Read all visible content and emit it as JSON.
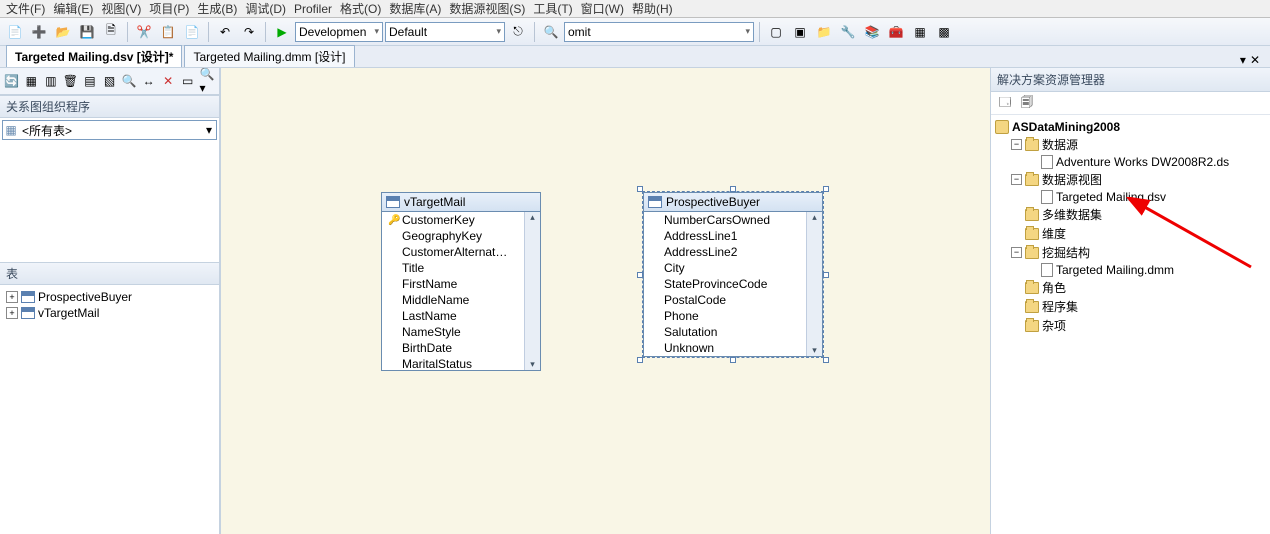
{
  "menu": {
    "items": [
      "文件(F)",
      "编辑(E)",
      "视图(V)",
      "项目(P)",
      "生成(B)",
      "调试(D)",
      "Profiler",
      "格式(O)",
      "数据库(A)",
      "数据源视图(S)",
      "工具(T)",
      "窗口(W)",
      "帮助(H)"
    ]
  },
  "toolbar": {
    "run_label": "Developmen",
    "config_label": "Default",
    "find_value": "omit"
  },
  "docTabs": {
    "active": "Targeted Mailing.dsv [设计]*",
    "other": "Targeted Mailing.dmm [设计]"
  },
  "leftPanel": {
    "diagramOrganizer": "关系图组织程序",
    "allTablesFilter": "<所有表>",
    "tablesHeader": "表",
    "tables": [
      "ProspectiveBuyer",
      "vTargetMail"
    ]
  },
  "canvas": {
    "table1": {
      "title": "vTargetMail",
      "cols": [
        "CustomerKey",
        "GeographyKey",
        "CustomerAlternat…",
        "Title",
        "FirstName",
        "MiddleName",
        "LastName",
        "NameStyle",
        "BirthDate",
        "MaritalStatus"
      ],
      "keyIndex": 0
    },
    "table2": {
      "title": "ProspectiveBuyer",
      "cols": [
        "NumberCarsOwned",
        "AddressLine1",
        "AddressLine2",
        "City",
        "StateProvinceCode",
        "PostalCode",
        "Phone",
        "Salutation",
        "Unknown"
      ]
    }
  },
  "solution": {
    "title": "解决方案资源管理器",
    "project": "ASDataMining2008",
    "dataSources": "数据源",
    "dsItem": "Adventure Works DW2008R2.ds",
    "dsViews": "数据源视图",
    "dsvItem": "Targeted Mailing.dsv",
    "cubes": "多维数据集",
    "dimensions": "维度",
    "mining": "挖掘结构",
    "miningItem": "Targeted Mailing.dmm",
    "roles": "角色",
    "assemblies": "程序集",
    "misc": "杂项"
  }
}
